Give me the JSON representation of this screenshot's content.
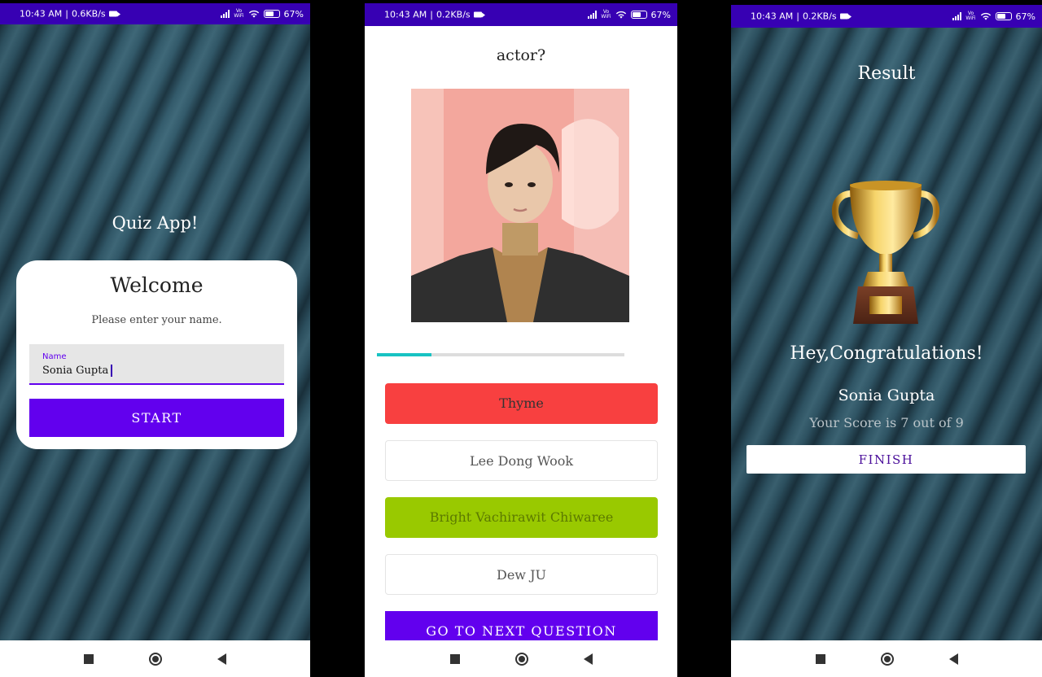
{
  "screen1": {
    "status": {
      "time": "10:43 AM",
      "speed": "0.6KB/s",
      "vo": "Vo",
      "wifi": "WiFi",
      "battery": "67"
    },
    "app_title": "Quiz App!",
    "card": {
      "title": "Welcome",
      "subtitle": "Please enter your name.",
      "name_label": "Name",
      "name_value": "Sonia Gupta",
      "start_label": "START"
    }
  },
  "screen2": {
    "status": {
      "time": "10:43 AM",
      "speed": "0.2KB/s",
      "vo": "Vo",
      "wifi": "WiFi",
      "battery": "67"
    },
    "question_fragment": "actor?",
    "progress_fraction": 0.22,
    "options": [
      "Thyme",
      "Lee Dong Wook",
      "Bright Vachirawit Chiwaree",
      "Dew JU"
    ],
    "next_label": "GO TO NEXT QUESTION"
  },
  "screen3": {
    "status": {
      "time": "10:43 AM",
      "speed": "0.2KB/s",
      "vo": "Vo",
      "wifi": "WiFi",
      "battery": "67"
    },
    "title": "Result",
    "congrats": "Hey,Congratulations!",
    "name": "Sonia Gupta",
    "score": "Your Score is 7 out of 9",
    "finish_label": "FINISH"
  },
  "colors": {
    "status_bar": "#3700b3",
    "primary": "#6200ee",
    "wrong_answer": "#f84040",
    "correct_answer": "#99c900",
    "progress": "#18c3c3"
  },
  "icons": [
    "video-camera-icon",
    "signal-icon",
    "wifi-icon",
    "battery-icon",
    "nav-recents-icon",
    "nav-home-icon",
    "nav-back-icon",
    "trophy-icon"
  ]
}
